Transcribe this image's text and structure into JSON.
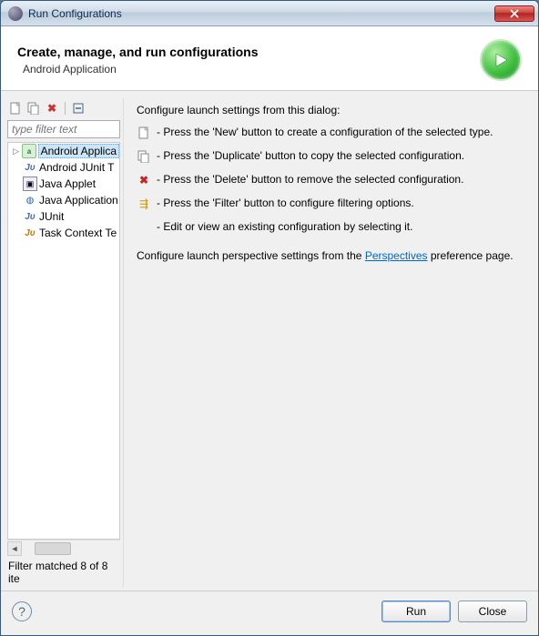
{
  "window": {
    "title": "Run Configurations"
  },
  "header": {
    "title": "Create, manage, and run configurations",
    "subtitle": "Android Application"
  },
  "toolbar_icons": {
    "new": "new-config",
    "duplicate": "duplicate-config",
    "delete": "delete-config",
    "collapse": "collapse-all"
  },
  "filter": {
    "placeholder": "type filter text"
  },
  "tree": {
    "items": [
      {
        "label": "Android Applica",
        "icon": "android",
        "selected": true,
        "expandable": true
      },
      {
        "label": "Android JUnit T",
        "icon": "ju",
        "selected": false,
        "expandable": false
      },
      {
        "label": "Java Applet",
        "icon": "applet",
        "selected": false,
        "expandable": false
      },
      {
        "label": "Java Application",
        "icon": "java",
        "selected": false,
        "expandable": false
      },
      {
        "label": "JUnit",
        "icon": "ju",
        "selected": false,
        "expandable": false
      },
      {
        "label": "Task Context Te",
        "icon": "ju-orange",
        "selected": false,
        "expandable": false
      }
    ]
  },
  "status": "Filter matched 8 of 8 ite",
  "right": {
    "title": "Configure launch settings from this dialog:",
    "hints": [
      "- Press the 'New' button to create a configuration of the selected type.",
      "- Press the 'Duplicate' button to copy the selected configuration.",
      "- Press the 'Delete' button to remove the selected configuration.",
      "- Press the 'Filter' button to configure filtering options.",
      "- Edit or view an existing configuration by selecting it."
    ],
    "paragraph_prefix": "Configure launch perspective settings from the ",
    "paragraph_link": "Perspectives",
    "paragraph_suffix": " preference page."
  },
  "footer": {
    "run": "Run",
    "close": "Close"
  }
}
